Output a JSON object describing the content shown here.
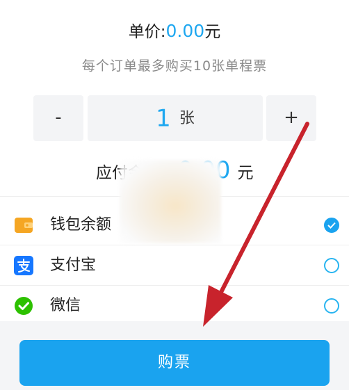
{
  "price": {
    "label": "单价:",
    "value": "0.00",
    "unit": "元"
  },
  "limit_note": "每个订单最多购买10张单程票",
  "stepper": {
    "minus_label": "-",
    "quantity": "1",
    "unit": "张",
    "plus_label": "+"
  },
  "total": {
    "label": "应付金额:",
    "value": "0.00",
    "unit": "元"
  },
  "payment_methods": [
    {
      "name": "钱包余额",
      "icon": "wallet-icon",
      "selected": true
    },
    {
      "name": "支付宝",
      "icon": "alipay-icon",
      "selected": false
    },
    {
      "name": "微信",
      "icon": "wechat-icon",
      "selected": false
    }
  ],
  "buy_button_label": "购票",
  "colors": {
    "accent": "#1aa3ef",
    "wallet": "#f5a623",
    "alipay": "#1677ff",
    "wechat": "#2dc100",
    "arrow": "#c8232c"
  }
}
